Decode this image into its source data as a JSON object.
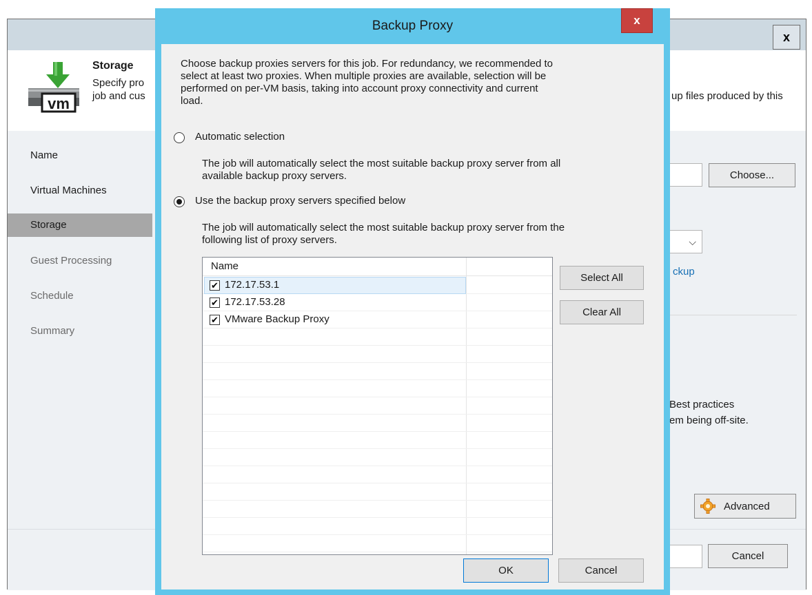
{
  "background_window": {
    "close_label": "x",
    "step_title": "Storage",
    "step_desc_line1": "Specify pro",
    "step_desc_line2": "job and cus",
    "step_desc_right": "up files produced by this",
    "nav": [
      {
        "label": "Name",
        "state": "normal"
      },
      {
        "label": "Virtual Machines",
        "state": "normal"
      },
      {
        "label": "Storage",
        "state": "active"
      },
      {
        "label": "Guest Processing",
        "state": "disabled"
      },
      {
        "label": "Schedule",
        "state": "disabled"
      },
      {
        "label": "Summary",
        "state": "disabled"
      }
    ],
    "choose_button": "Choose...",
    "dropdown_chevron": "⌵",
    "link_partial": "ckup",
    "best_practices_line1": "Best practices",
    "best_practices_line2": "em being off-site.",
    "advanced_button": "Advanced",
    "cancel_button": "Cancel"
  },
  "dialog": {
    "title": "Backup Proxy",
    "close_label": "x",
    "intro_lines": [
      "Choose backup proxies servers for this job. For redundancy, we recommended to",
      "select at least two proxies. When multiple proxies are available, selection will be",
      "performed on per-VM basis, taking into account proxy connectivity and current",
      "load."
    ],
    "option_auto": {
      "label": "Automatic selection",
      "selected": false,
      "desc_lines": [
        "The job will automatically select the most suitable backup proxy server from all",
        "available backup proxy servers."
      ]
    },
    "option_specified": {
      "label": "Use the backup proxy servers specified below",
      "selected": true,
      "desc_lines": [
        "The job will automatically select the most suitable backup proxy server from the",
        "following list of proxy servers."
      ]
    },
    "table": {
      "column_header": "Name",
      "rows": [
        {
          "name": "172.17.53.1",
          "checked": true,
          "selected": true
        },
        {
          "name": "172.17.53.28",
          "checked": true,
          "selected": false
        },
        {
          "name": "VMware Backup Proxy",
          "checked": true,
          "selected": false
        }
      ]
    },
    "select_all_button": "Select All",
    "clear_all_button": "Clear All",
    "ok_button": "OK",
    "cancel_button": "Cancel"
  },
  "colors": {
    "dialog_frame": "#60c6ea",
    "close_button": "#c8423e",
    "nav_active": "#a7a7a7",
    "link": "#1770b5"
  }
}
